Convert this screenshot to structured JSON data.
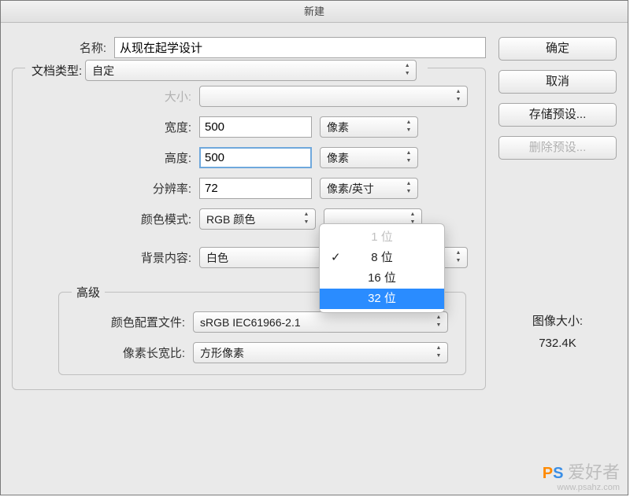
{
  "title": "新建",
  "labels": {
    "name": "名称:",
    "docType": "文档类型:",
    "size": "大小:",
    "width": "宽度:",
    "height": "高度:",
    "resolution": "分辨率:",
    "colorMode": "颜色模式:",
    "background": "背景内容:",
    "advanced": "高级",
    "colorProfile": "颜色配置文件:",
    "pixelAspect": "像素长宽比:"
  },
  "values": {
    "name": "从现在起学设计",
    "docType": "自定",
    "size": "",
    "width": "500",
    "height": "500",
    "resolution": "72",
    "colorMode": "RGB 颜色",
    "background": "白色",
    "colorProfile": "sRGB IEC61966-2.1",
    "pixelAspect": "方形像素"
  },
  "units": {
    "width": "像素",
    "height": "像素",
    "resolution": "像素/英寸"
  },
  "bitDepthOptions": {
    "opt0": "1 位",
    "opt1": "8 位",
    "opt2": "16 位",
    "opt3": "32 位"
  },
  "buttons": {
    "ok": "确定",
    "cancel": "取消",
    "savePreset": "存储预设...",
    "deletePreset": "删除预设..."
  },
  "imageSize": {
    "label": "图像大小:",
    "value": "732.4K"
  },
  "watermark": {
    "p": "P",
    "s": "S",
    "txt": "爱好者",
    "url": "www.psahz.com"
  }
}
